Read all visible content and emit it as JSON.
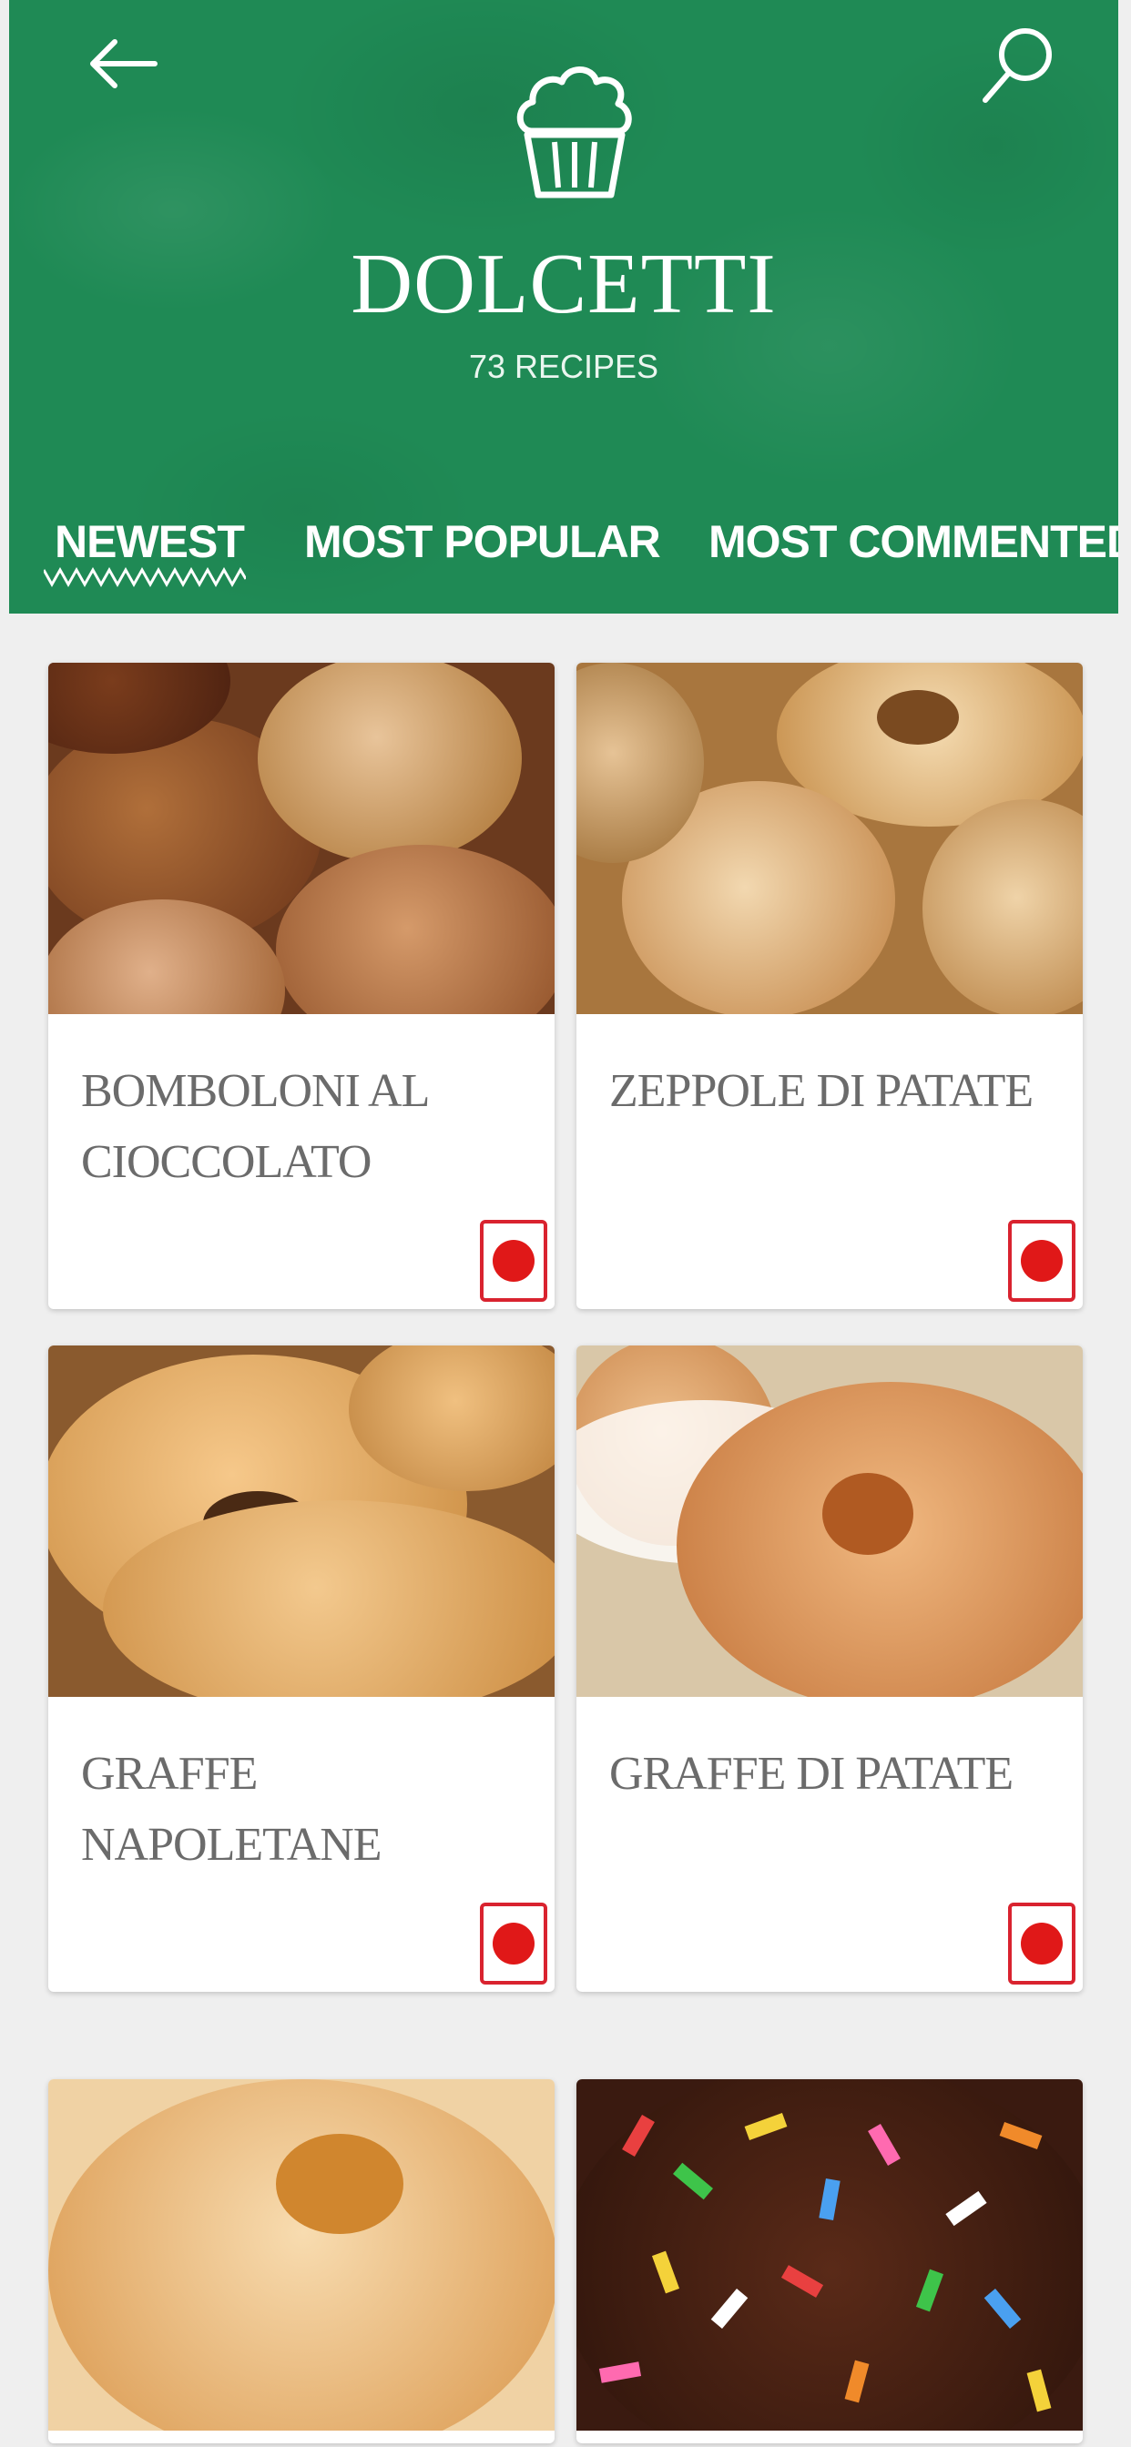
{
  "header": {
    "title": "DOLCETTI",
    "subtitle": "73 RECIPES",
    "background_color": "#1f8a55",
    "back_icon": "arrow-left-icon",
    "search_icon": "search-icon",
    "category_icon": "muffin-icon"
  },
  "tabs": [
    {
      "label": "NEWEST",
      "selected": true
    },
    {
      "label": "MOST POPULAR",
      "selected": false
    },
    {
      "label": "MOST COMMENTED",
      "selected": false
    }
  ],
  "recipes": [
    {
      "name": "BOMBOLONI AL CIOCCOLATO",
      "badge_color": "#e01818"
    },
    {
      "name": "ZEPPOLE DI PATATE",
      "badge_color": "#e01818"
    },
    {
      "name": "GRAFFE NAPOLETANE",
      "badge_color": "#e01818"
    },
    {
      "name": "GRAFFE DI PATATE",
      "badge_color": "#e01818"
    },
    {
      "name": "",
      "badge_color": "#e01818"
    },
    {
      "name": "",
      "badge_color": "#e01818"
    }
  ]
}
